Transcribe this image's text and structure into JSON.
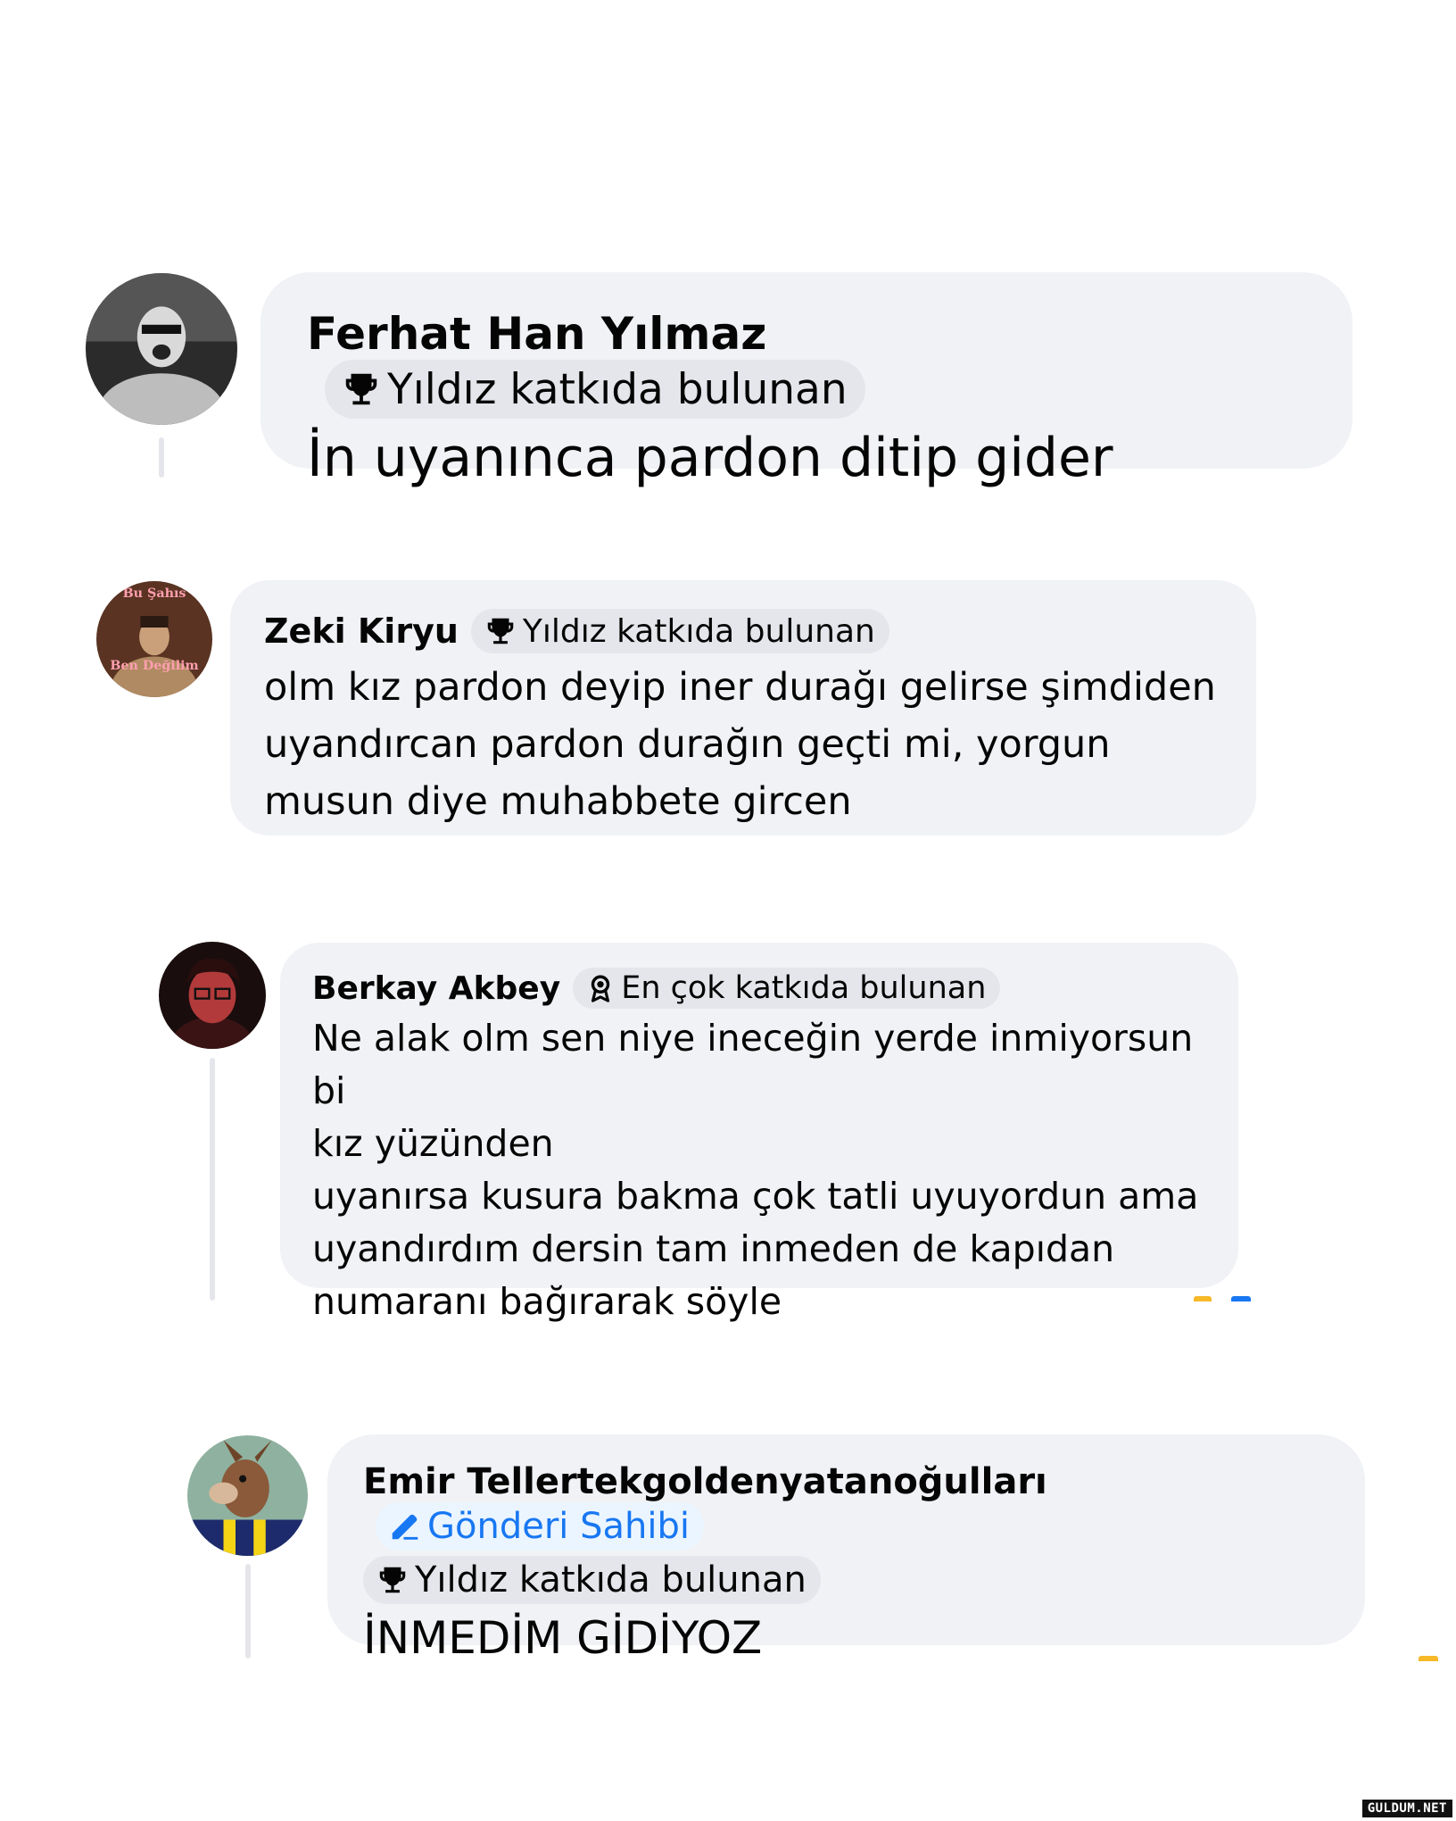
{
  "comments": [
    {
      "author": "Ferhat Han Yılmaz",
      "badges": [
        {
          "label": "Yıldız katkıda bulunan",
          "icon": "trophy-icon"
        }
      ],
      "text": "İn uyanınca pardon ditip gider"
    },
    {
      "author": "Zeki Kiryu",
      "avatar_text": [
        "Bu Şahıs",
        "Ben Değilim"
      ],
      "badges": [
        {
          "label": "Yıldız katkıda bulunan",
          "icon": "trophy-icon"
        }
      ],
      "text": "olm kız pardon deyip iner durağı gelirse şimdiden\nuyandırcan pardon durağın geçti mi, yorgun\nmusun diye muhabbete gircen"
    },
    {
      "author": "Berkay Akbey",
      "badges": [
        {
          "label": "En çok katkıda bulunan",
          "icon": "medal-icon"
        }
      ],
      "text": "Ne alak olm sen niye ineceğin yerde inmiyorsun bi\nkız yüzünden\nuyanırsa kusura bakma çok tatli uyuyordun ama\nuyandırdım dersin tam inmeden de kapıdan\nnumaranı bağırarak söyle"
    },
    {
      "author": "Emir Tellertekgoldenyatanoğulları",
      "badges": [
        {
          "label": "Gönderi Sahibi",
          "icon": "pencil-icon"
        },
        {
          "label": "Yıldız katkıda bulunan",
          "icon": "trophy-icon"
        }
      ],
      "text": "İNMEDİM GİDİYOZ"
    }
  ],
  "watermark": "GULDUM.NET",
  "colors": {
    "bubble": "#f0f2f5",
    "badge": "#e4e6eb",
    "owner_badge_text": "#1877f2",
    "thread_line": "#e4e6eb"
  }
}
